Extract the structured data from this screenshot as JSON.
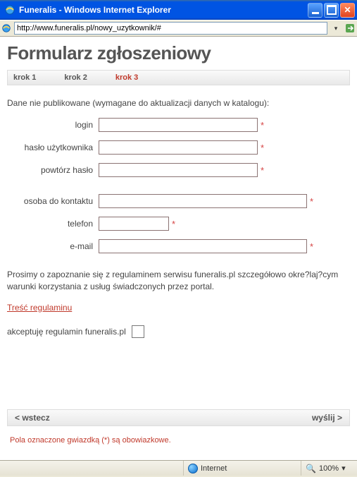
{
  "window": {
    "title": "Funeralis - Windows Internet Explorer",
    "url": "http://www.funeralis.pl/nowy_uzytkownik/#"
  },
  "page": {
    "heading": "Formularz zgłoszeniowy"
  },
  "steps": {
    "s1": "krok 1",
    "s2": "krok 2",
    "s3": "krok 3"
  },
  "intro": "Dane nie publikowane (wymagane do aktualizacji danych w katalogu):",
  "fields": {
    "login": {
      "label": "login"
    },
    "password": {
      "label": "hasło użytkownika"
    },
    "password2": {
      "label": "powtórz hasło"
    },
    "contact": {
      "label": "osoba do kontaktu"
    },
    "phone": {
      "label": "telefon"
    },
    "email": {
      "label": "e-mail"
    }
  },
  "regul": {
    "text": "Prosimy o zapoznanie się z regulaminem serwisu funeralis.pl szczegółowo okre?laj?cym warunki korzystania z usług świadczonych przez portal.",
    "link": "Treść regulaminu",
    "accept": "akceptuję regulamin funeralis.pl"
  },
  "nav": {
    "back": "< wstecz",
    "send": "wyślij >"
  },
  "reqnote": "Pola oznaczone gwiazdką (*) są obowiazkowe.",
  "status": {
    "zone": "Internet",
    "zoom": "100%"
  },
  "asterisk": "*"
}
